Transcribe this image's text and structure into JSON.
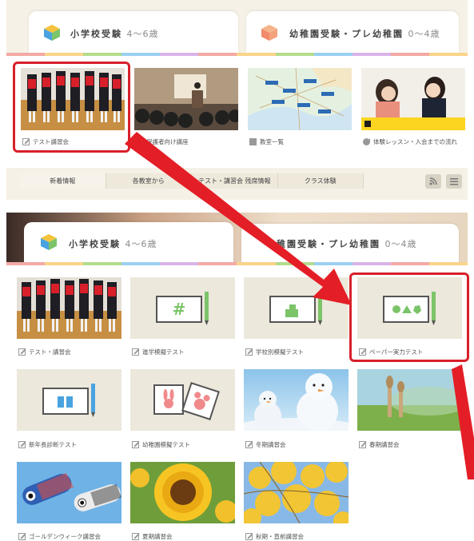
{
  "top": {
    "tab_elementary": {
      "label": "小学校受験",
      "age": "4〜6歳"
    },
    "tab_kinder": {
      "label": "幼稚園受験・プレ幼稚園",
      "age": "0〜4歳"
    },
    "tiles": [
      {
        "caption": "テスト講習会"
      },
      {
        "caption": "保護者向け講座"
      },
      {
        "caption": "教室一覧"
      },
      {
        "caption": "体験レッスン・入会までの流れ"
      }
    ],
    "nav": [
      "新着情報",
      "各教室から",
      "テスト・講習会 残席情報",
      "クラス体験"
    ],
    "map_labels": [
      "教室",
      "教室",
      "教室",
      "教室",
      "教室",
      "教室",
      "教室"
    ]
  },
  "bottom": {
    "tab_elementary": {
      "label": "小学校受験",
      "age": "4〜6歳"
    },
    "tab_kinder": {
      "label": "稚園受験・プレ幼稚園",
      "age": "0〜4歳"
    },
    "tiles": [
      {
        "caption": "テスト・講習会"
      },
      {
        "caption": "進学模擬テスト"
      },
      {
        "caption": "学校別模擬テスト"
      },
      {
        "caption": "ペーパー実力テスト"
      },
      {
        "caption": "新年長診断テスト"
      },
      {
        "caption": "幼稚園模擬テスト"
      },
      {
        "caption": "冬期講習会"
      },
      {
        "caption": "春期講習会"
      },
      {
        "caption": "ゴールデンウィーク講習会"
      },
      {
        "caption": "夏期講習会"
      },
      {
        "caption": "秋期・直前講習会"
      }
    ]
  },
  "colors": {
    "accent_red": "#d8202a",
    "stripe": [
      "#f3a9a4",
      "#f9d48a",
      "#b4dc8c",
      "#9ad0f2",
      "#d9b4e8",
      "#f3a9a4",
      "#f9d48a",
      "#b4dc8c",
      "#9ad0f2",
      "#d9b4e8",
      "#f3a9a4",
      "#f9d48a"
    ]
  }
}
